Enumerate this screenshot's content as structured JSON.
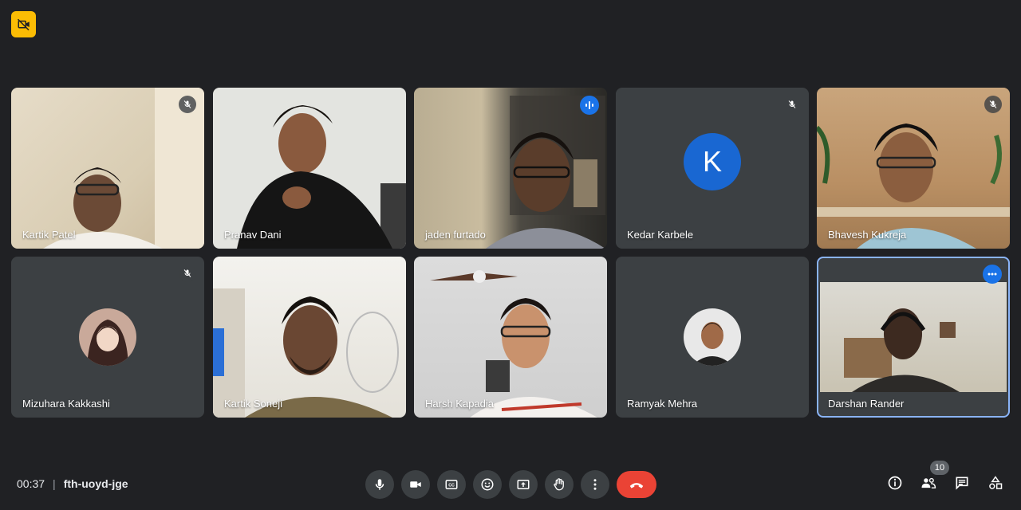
{
  "meeting": {
    "time": "00:37",
    "code": "fth-uoyd-jge",
    "participant_count": "10"
  },
  "participants": [
    {
      "name": "Kartik Patel",
      "mic": "muted"
    },
    {
      "name": "Pranav Dani",
      "mic": "on"
    },
    {
      "name": "jaden furtado",
      "mic": "speaking"
    },
    {
      "name": "Kedar Karbele",
      "mic": "muted",
      "initial": "K"
    },
    {
      "name": "Bhavesh Kukreja",
      "mic": "muted"
    },
    {
      "name": "Mizuhara Kakkashi",
      "mic": "muted"
    },
    {
      "name": "Kartik Soneji",
      "mic": "on"
    },
    {
      "name": "Harsh Kapadia",
      "mic": "on"
    },
    {
      "name": "Ramyak Mehra",
      "mic": "on"
    },
    {
      "name": "Darshan Rander",
      "mic": "on"
    }
  ],
  "icons": {
    "recording": "camera-off-icon",
    "controls": [
      "microphone-icon",
      "camera-icon",
      "captions-icon",
      "emoji-icon",
      "present-screen-icon",
      "raise-hand-icon",
      "more-options-icon",
      "end-call-icon"
    ],
    "right": [
      "info-icon",
      "people-icon",
      "chat-icon",
      "activities-icon"
    ]
  },
  "colors": {
    "background": "#202124",
    "tile": "#3c4043",
    "end_call": "#ea4335",
    "accent": "#1a73e8",
    "badge": "#fbbc04"
  }
}
